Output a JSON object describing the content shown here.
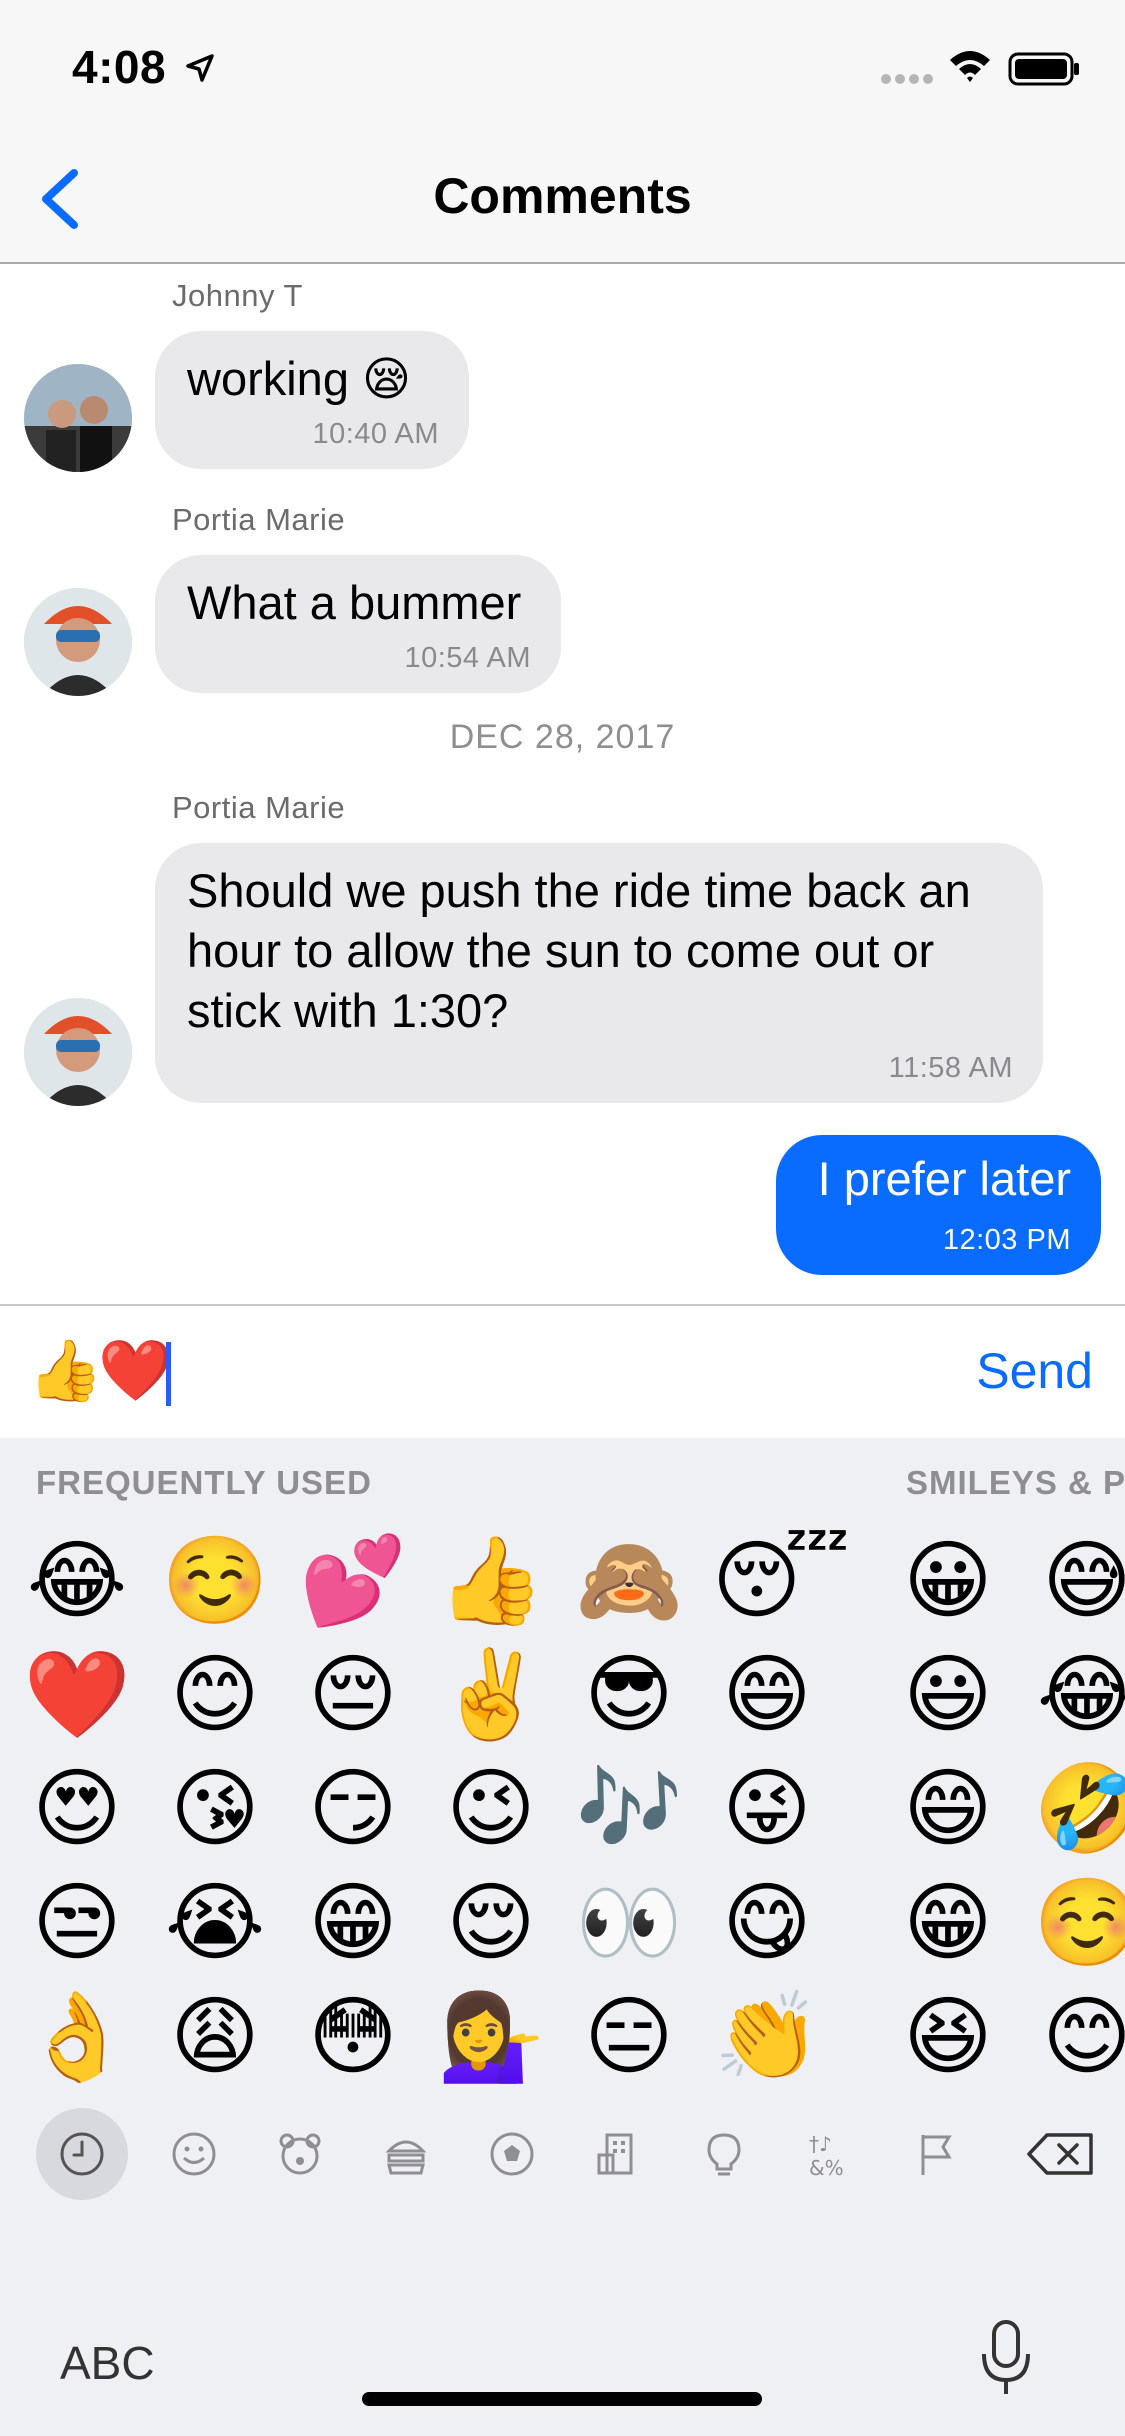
{
  "status_bar": {
    "time": "4:08"
  },
  "nav": {
    "title": "Comments"
  },
  "comments": [
    {
      "sender": "Johnny T",
      "text": "working 😪",
      "time": "10:40 AM"
    },
    {
      "sender": "Portia Marie",
      "text": "What a bummer",
      "time": "10:54 AM"
    },
    {
      "date": "DEC 28, 2017"
    },
    {
      "sender": "Portia Marie",
      "text": "Should we push the ride time back an hour to allow the sun to come out or stick with 1:30?",
      "time": "11:58 AM"
    },
    {
      "text": "I prefer later",
      "time": "12:03 PM",
      "own": true
    }
  ],
  "composer": {
    "draft": [
      "👍",
      "❤️"
    ],
    "send_label": "Send"
  },
  "keyboard": {
    "sections": [
      "FREQUENTLY USED",
      "SMILEYS & P"
    ],
    "frequently_used": [
      "😂",
      "☺️",
      "💕",
      "👍",
      "🙈",
      "😴",
      "❤️",
      "😊",
      "😔",
      "✌️",
      "😎",
      "😄",
      "😍",
      "😘",
      "😏",
      "😉",
      "🎶",
      "😜",
      "😒",
      "😭",
      "😁",
      "😌",
      "👀",
      "😋",
      "👌",
      "😩",
      "😳",
      "💁‍♀️",
      "😑",
      "👏"
    ],
    "smileys": [
      "😀",
      "😅",
      "😃",
      "😂",
      "😄",
      "🤣",
      "😁",
      "☺️",
      "😆",
      "😊"
    ],
    "categories": [
      "clock-icon",
      "smiley-icon",
      "bear-icon",
      "food-icon",
      "ball-icon",
      "building-icon",
      "bulb-icon",
      "symbols-icon",
      "flag-icon"
    ],
    "abc_label": "ABC"
  }
}
